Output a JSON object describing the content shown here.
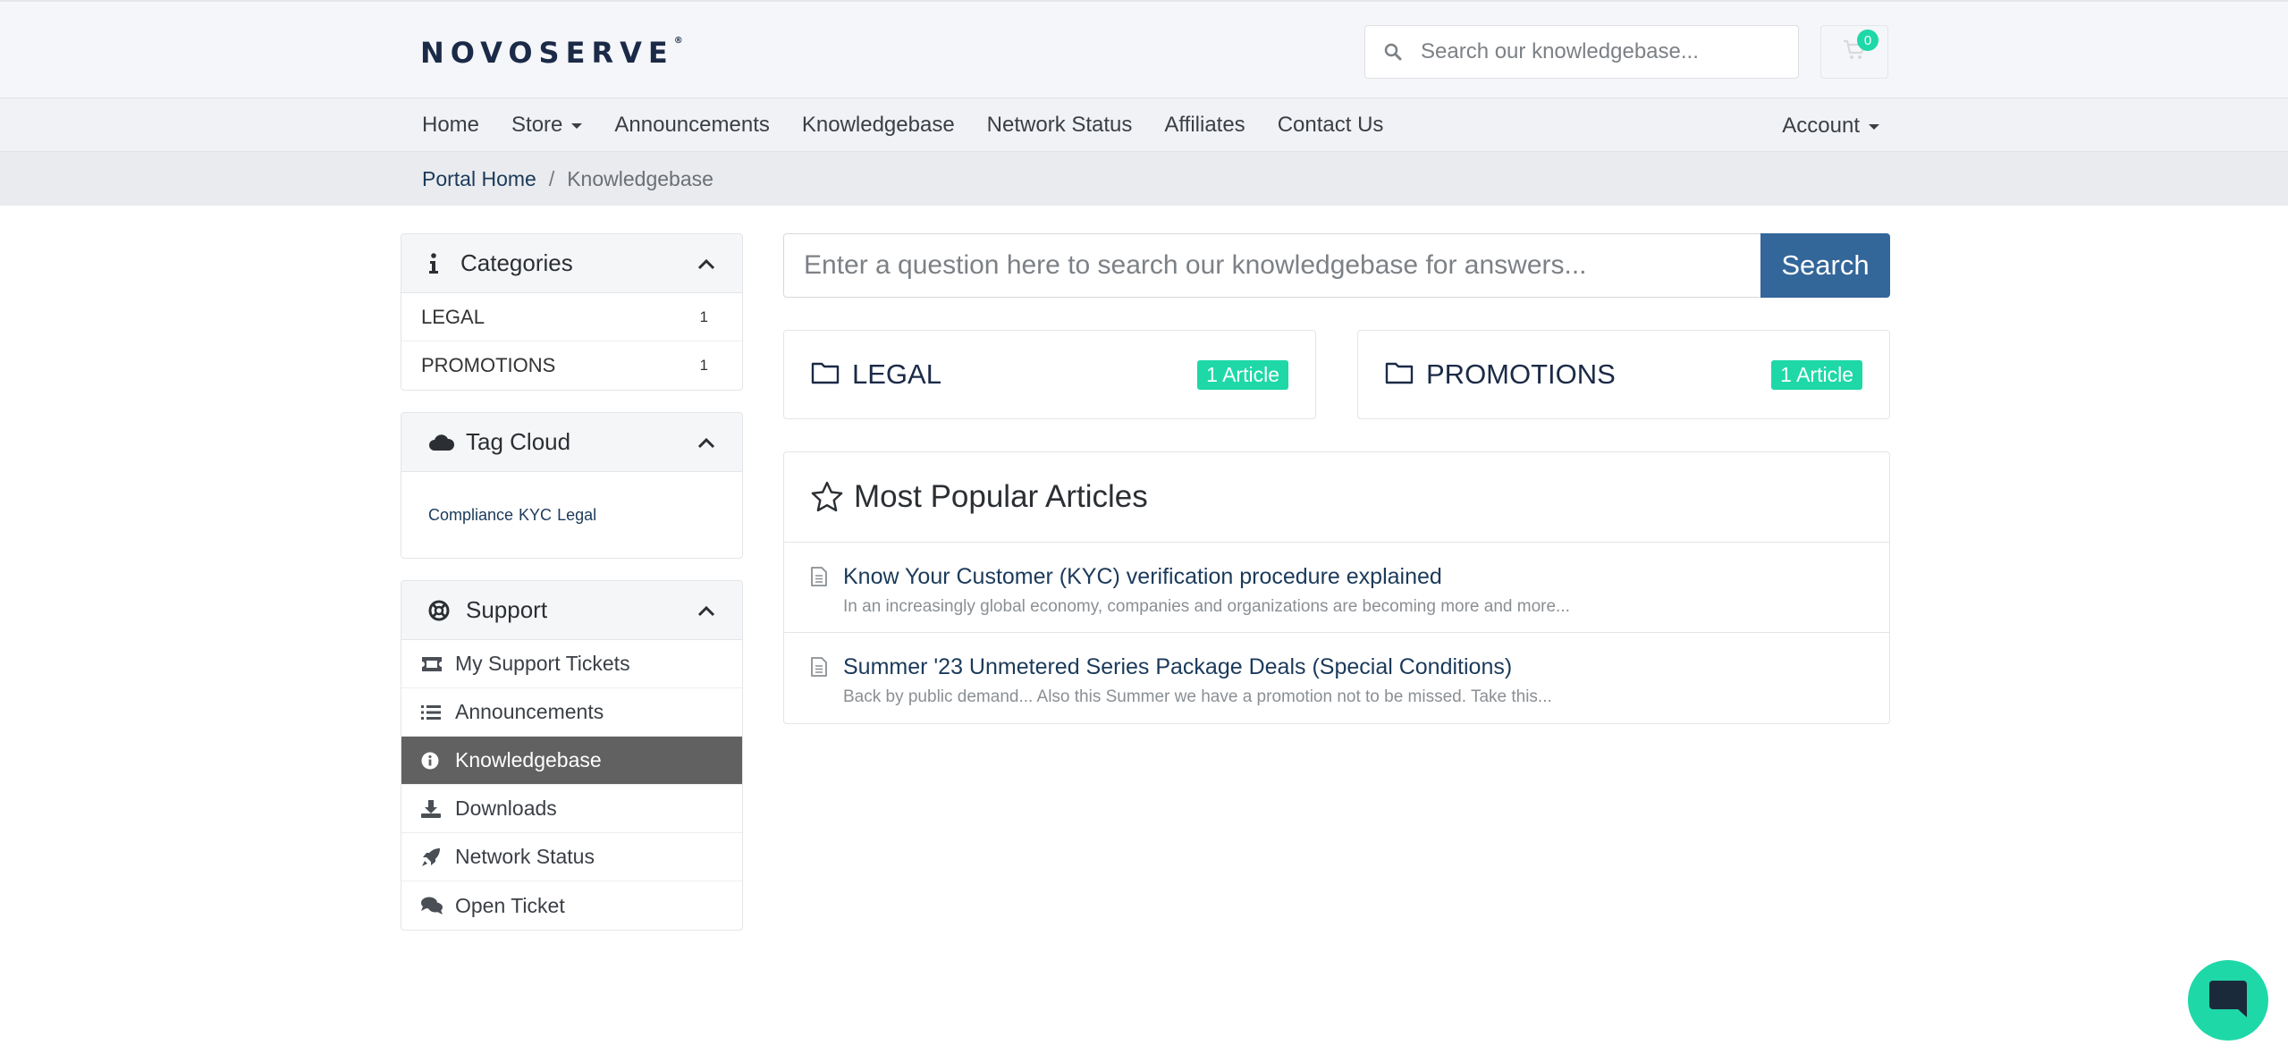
{
  "header": {
    "logo": "NOVOSERVE",
    "logo_mark": "®",
    "search_placeholder": "Search our knowledgebase...",
    "cart_count": "0"
  },
  "nav": {
    "items": [
      "Home",
      "Store",
      "Announcements",
      "Knowledgebase",
      "Network Status",
      "Affiliates",
      "Contact Us"
    ],
    "account": "Account"
  },
  "breadcrumb": {
    "home": "Portal Home",
    "separator": "/",
    "current": "Knowledgebase"
  },
  "sidebar": {
    "categories": {
      "title": "Categories",
      "items": [
        {
          "label": "LEGAL",
          "count": "1"
        },
        {
          "label": "PROMOTIONS",
          "count": "1"
        }
      ]
    },
    "tagcloud": {
      "title": "Tag Cloud",
      "tags": [
        "Compliance",
        "KYC",
        "Legal"
      ]
    },
    "support": {
      "title": "Support",
      "items": [
        {
          "label": "My Support Tickets",
          "icon": "ticket-icon"
        },
        {
          "label": "Announcements",
          "icon": "list-icon"
        },
        {
          "label": "Knowledgebase",
          "icon": "info-circle-icon"
        },
        {
          "label": "Downloads",
          "icon": "download-icon"
        },
        {
          "label": "Network Status",
          "icon": "rocket-icon"
        },
        {
          "label": "Open Ticket",
          "icon": "comments-icon"
        }
      ],
      "active_index": 2
    }
  },
  "main": {
    "search_placeholder": "Enter a question here to search our knowledgebase for answers...",
    "search_button": "Search",
    "categories": [
      {
        "name": "LEGAL",
        "count_label": "1 Article"
      },
      {
        "name": "PROMOTIONS",
        "count_label": "1 Article"
      }
    ],
    "popular": {
      "title": "Most Popular Articles",
      "articles": [
        {
          "title": "Know Your Customer (KYC) verification procedure explained",
          "excerpt": "In an increasingly global economy, companies and organizations are becoming more and more..."
        },
        {
          "title": "Summer '23 Unmetered Series Package Deals (Special Conditions)",
          "excerpt": "Back by public demand... Also this Summer we have a promotion not to be missed. Take this..."
        }
      ]
    }
  },
  "colors": {
    "accent": "#1ed8a8",
    "primary_button": "#336699",
    "active_sidebar": "#616161",
    "brand_text": "#1b2a47"
  }
}
